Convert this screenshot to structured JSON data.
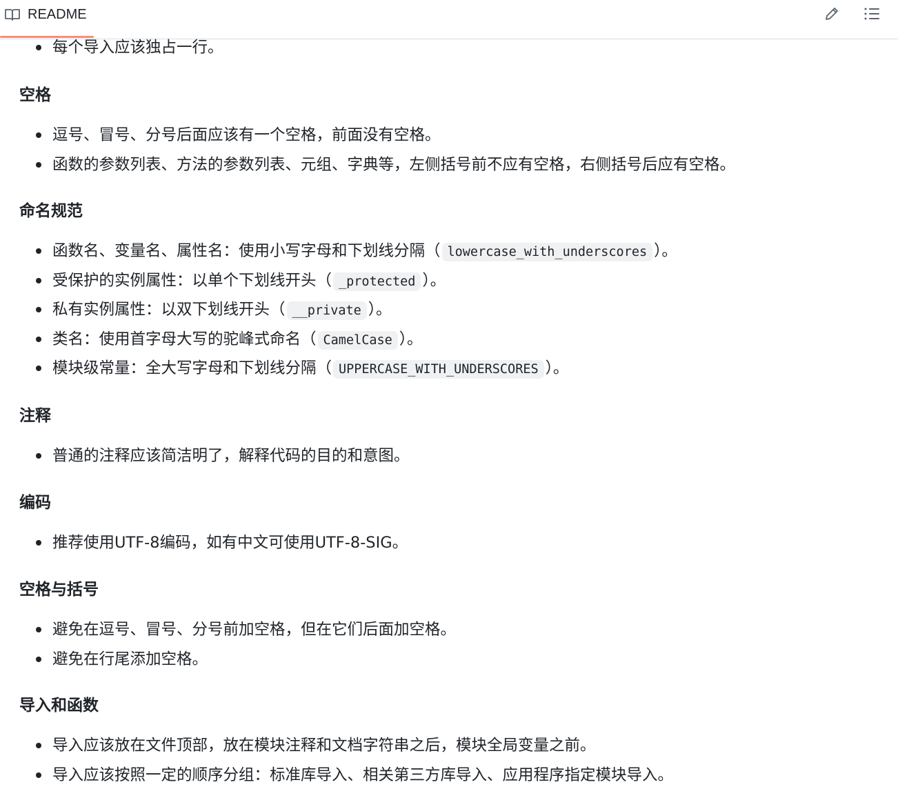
{
  "header": {
    "tab_label": "README",
    "edit_icon": "pencil-icon",
    "toc_icon": "list-unordered-icon",
    "tab_icon": "book-icon",
    "accent": "#fd8c73"
  },
  "sections": {
    "intro": {
      "items": [
        "每个导入应该独占一行。"
      ]
    },
    "spaces": {
      "title": "空格",
      "items": [
        "逗号、冒号、分号后面应该有一个空格，前面没有空格。",
        "函数的参数列表、方法的参数列表、元组、字典等，左侧括号前不应有空格，右侧括号后应有空格。"
      ]
    },
    "naming": {
      "title": "命名规范",
      "items": [
        {
          "text": "函数名、变量名、属性名：使用小写字母和下划线分隔（",
          "code": "lowercase_with_underscores",
          "tail": "）。"
        },
        {
          "text": "受保护的实例属性：以单个下划线开头（",
          "code": "_protected",
          "tail": "）。"
        },
        {
          "text": "私有实例属性：以双下划线开头（",
          "code": "__private",
          "tail": "）。"
        },
        {
          "text": "类名：使用首字母大写的驼峰式命名（",
          "code": "CamelCase",
          "tail": "）。"
        },
        {
          "text": "模块级常量：全大写字母和下划线分隔（",
          "code": "UPPERCASE_WITH_UNDERSCORES",
          "tail": "）。"
        }
      ]
    },
    "comments": {
      "title": "注释",
      "items": [
        "普通的注释应该简洁明了，解释代码的目的和意图。"
      ]
    },
    "encoding": {
      "title": "编码",
      "items": [
        "推荐使用UTF-8编码，如有中文可使用UTF-8-SIG。"
      ]
    },
    "spaces_brackets": {
      "title": "空格与括号",
      "items": [
        "避免在逗号、冒号、分号前加空格，但在它们后面加空格。",
        "避免在行尾添加空格。"
      ]
    },
    "imports": {
      "title": "导入和函数",
      "items": [
        "导入应该放在文件顶部，放在模块注释和文档字符串之后，模块全局变量之前。",
        "导入应该按照一定的顺序分组：标准库导入、相关第三方库导入、应用程序指定模块导入。"
      ]
    }
  }
}
